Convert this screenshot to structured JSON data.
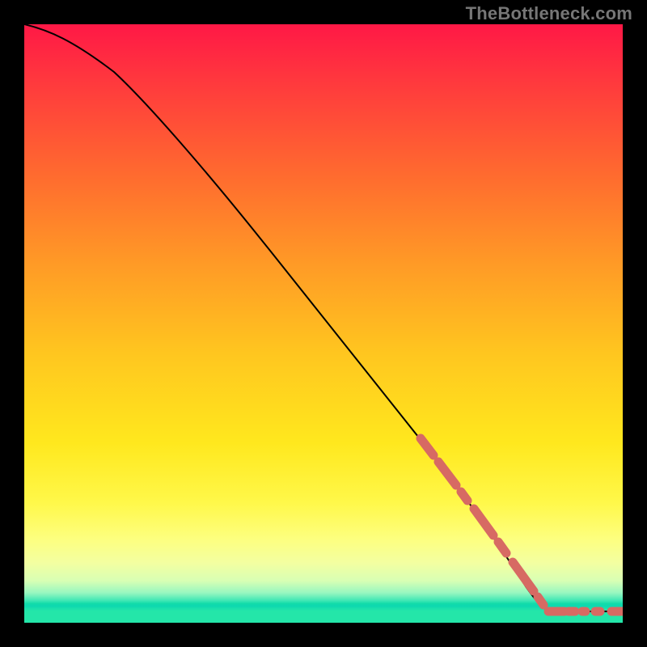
{
  "branding": "TheBottleneck.com",
  "chart_data": {
    "type": "line",
    "title": "",
    "xlabel": "",
    "ylabel": "",
    "xlim": [
      0,
      100
    ],
    "ylim": [
      0,
      100
    ],
    "curve": [
      {
        "x": 0,
        "y": 100
      },
      {
        "x": 4,
        "y": 99
      },
      {
        "x": 9,
        "y": 97
      },
      {
        "x": 15,
        "y": 92
      },
      {
        "x": 20,
        "y": 86
      },
      {
        "x": 30,
        "y": 74
      },
      {
        "x": 40,
        "y": 61
      },
      {
        "x": 50,
        "y": 48
      },
      {
        "x": 60,
        "y": 35
      },
      {
        "x": 68,
        "y": 25
      },
      {
        "x": 73,
        "y": 18
      },
      {
        "x": 78,
        "y": 11
      },
      {
        "x": 81,
        "y": 6
      },
      {
        "x": 84,
        "y": 3
      },
      {
        "x": 86,
        "y": 2
      },
      {
        "x": 90,
        "y": 2
      },
      {
        "x": 95,
        "y": 2
      },
      {
        "x": 100,
        "y": 2
      }
    ],
    "dashed_segments": [
      {
        "x_start": 66,
        "x_end": 85
      },
      {
        "x_start": 85,
        "x_end": 100
      }
    ],
    "marker_color": "#d76a63",
    "curve_color": "#000000",
    "gradient_stops": [
      {
        "pos": 0.0,
        "color": "#ff1846"
      },
      {
        "pos": 0.4,
        "color": "#ff9a26"
      },
      {
        "pos": 0.7,
        "color": "#ffe81e"
      },
      {
        "pos": 0.9,
        "color": "#f3ffa1"
      },
      {
        "pos": 0.97,
        "color": "#12dca9"
      },
      {
        "pos": 1.0,
        "color": "#24e6a9"
      }
    ]
  }
}
